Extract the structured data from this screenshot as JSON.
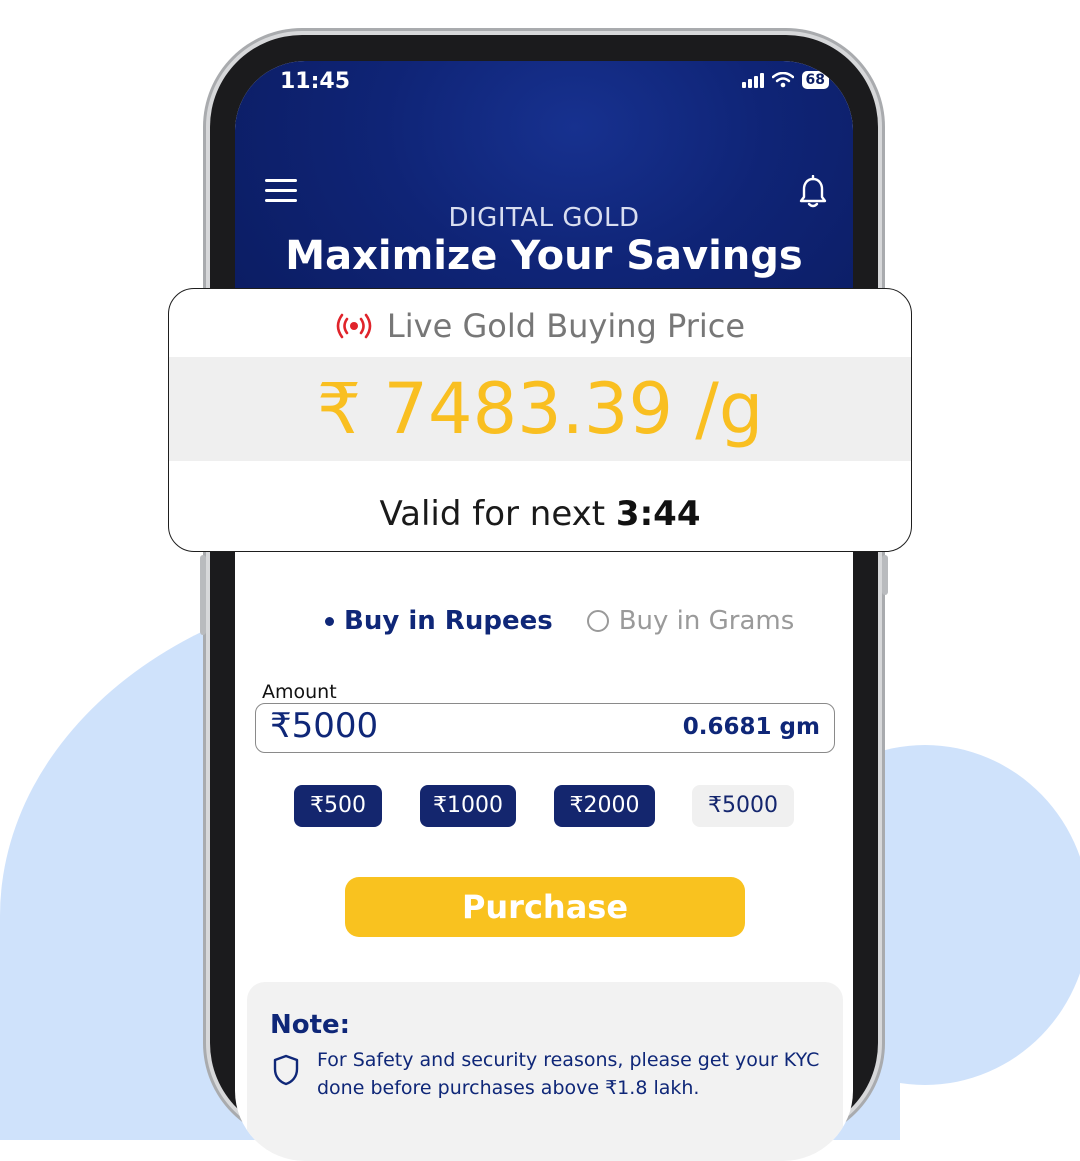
{
  "status_bar": {
    "time": "11:45",
    "battery": "68"
  },
  "header": {
    "subtitle": "DIGITAL GOLD",
    "title": "Maximize Your Savings"
  },
  "price_card": {
    "live_label": "Live Gold Buying Price",
    "price": "₹ 7483.39 /g",
    "valid_prefix": "Valid for next",
    "valid_time": "3:44"
  },
  "buy_mode": {
    "options": [
      "Buy in Rupees",
      "Buy in Grams"
    ],
    "selected": "Buy in Rupees"
  },
  "amount": {
    "label": "Amount",
    "value": "₹5000",
    "grams": "0.6681 gm"
  },
  "quick_amounts": [
    "₹500",
    "₹1000",
    "₹2000",
    "₹5000"
  ],
  "quick_selected": "₹5000",
  "purchase": {
    "label": "Purchase"
  },
  "note": {
    "title": "Note:",
    "text": "For Safety and security reasons, please get your KYC done before purchases above ₹1.8 lakh."
  },
  "colors": {
    "navy": "#0f2778",
    "gold": "#f9c21f",
    "cloud": "#cfe2fb",
    "live_red": "#e0242b"
  }
}
